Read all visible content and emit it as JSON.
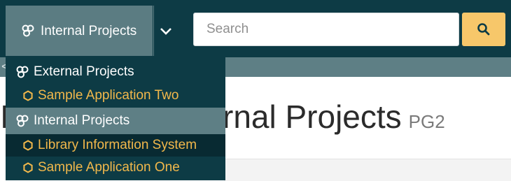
{
  "header": {
    "current_project": "Internal Projects",
    "search_placeholder": "Search"
  },
  "breadcrumb": {
    "visible_fragment": "<"
  },
  "page": {
    "title_visible_start": "I",
    "title_visible_rest": "rnal Projects",
    "code": "PG2"
  },
  "dropdown": {
    "items": [
      {
        "type": "group",
        "label": "External Projects",
        "icon": "project-group-icon"
      },
      {
        "type": "application",
        "label": "Sample Application Two",
        "icon": "hexagon-icon"
      },
      {
        "type": "group",
        "label": "Internal Projects",
        "icon": "project-group-icon",
        "active": true
      },
      {
        "type": "application",
        "label": "Library Information System",
        "icon": "hexagon-icon",
        "selected": true
      },
      {
        "type": "application",
        "label": "Sample Application One",
        "icon": "hexagon-icon"
      }
    ]
  },
  "colors": {
    "header_bg": "#0d3b45",
    "group_active_bg": "#5e7f85",
    "app_text": "#f2b84b",
    "search_button": "#f7c76a"
  }
}
